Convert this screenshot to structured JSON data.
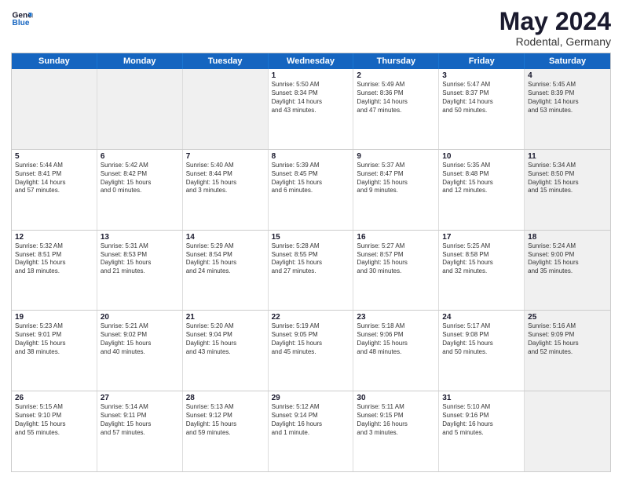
{
  "logo": {
    "line1": "General",
    "line2": "Blue"
  },
  "title": "May 2024",
  "location": "Rodental, Germany",
  "weekdays": [
    "Sunday",
    "Monday",
    "Tuesday",
    "Wednesday",
    "Thursday",
    "Friday",
    "Saturday"
  ],
  "rows": [
    [
      {
        "day": "",
        "text": "",
        "shaded": true
      },
      {
        "day": "",
        "text": "",
        "shaded": true
      },
      {
        "day": "",
        "text": "",
        "shaded": true
      },
      {
        "day": "1",
        "text": "Sunrise: 5:50 AM\nSunset: 8:34 PM\nDaylight: 14 hours\nand 43 minutes."
      },
      {
        "day": "2",
        "text": "Sunrise: 5:49 AM\nSunset: 8:36 PM\nDaylight: 14 hours\nand 47 minutes."
      },
      {
        "day": "3",
        "text": "Sunrise: 5:47 AM\nSunset: 8:37 PM\nDaylight: 14 hours\nand 50 minutes."
      },
      {
        "day": "4",
        "text": "Sunrise: 5:45 AM\nSunset: 8:39 PM\nDaylight: 14 hours\nand 53 minutes.",
        "shaded": true
      }
    ],
    [
      {
        "day": "5",
        "text": "Sunrise: 5:44 AM\nSunset: 8:41 PM\nDaylight: 14 hours\nand 57 minutes."
      },
      {
        "day": "6",
        "text": "Sunrise: 5:42 AM\nSunset: 8:42 PM\nDaylight: 15 hours\nand 0 minutes."
      },
      {
        "day": "7",
        "text": "Sunrise: 5:40 AM\nSunset: 8:44 PM\nDaylight: 15 hours\nand 3 minutes."
      },
      {
        "day": "8",
        "text": "Sunrise: 5:39 AM\nSunset: 8:45 PM\nDaylight: 15 hours\nand 6 minutes."
      },
      {
        "day": "9",
        "text": "Sunrise: 5:37 AM\nSunset: 8:47 PM\nDaylight: 15 hours\nand 9 minutes."
      },
      {
        "day": "10",
        "text": "Sunrise: 5:35 AM\nSunset: 8:48 PM\nDaylight: 15 hours\nand 12 minutes."
      },
      {
        "day": "11",
        "text": "Sunrise: 5:34 AM\nSunset: 8:50 PM\nDaylight: 15 hours\nand 15 minutes.",
        "shaded": true
      }
    ],
    [
      {
        "day": "12",
        "text": "Sunrise: 5:32 AM\nSunset: 8:51 PM\nDaylight: 15 hours\nand 18 minutes."
      },
      {
        "day": "13",
        "text": "Sunrise: 5:31 AM\nSunset: 8:53 PM\nDaylight: 15 hours\nand 21 minutes."
      },
      {
        "day": "14",
        "text": "Sunrise: 5:29 AM\nSunset: 8:54 PM\nDaylight: 15 hours\nand 24 minutes."
      },
      {
        "day": "15",
        "text": "Sunrise: 5:28 AM\nSunset: 8:55 PM\nDaylight: 15 hours\nand 27 minutes."
      },
      {
        "day": "16",
        "text": "Sunrise: 5:27 AM\nSunset: 8:57 PM\nDaylight: 15 hours\nand 30 minutes."
      },
      {
        "day": "17",
        "text": "Sunrise: 5:25 AM\nSunset: 8:58 PM\nDaylight: 15 hours\nand 32 minutes."
      },
      {
        "day": "18",
        "text": "Sunrise: 5:24 AM\nSunset: 9:00 PM\nDaylight: 15 hours\nand 35 minutes.",
        "shaded": true
      }
    ],
    [
      {
        "day": "19",
        "text": "Sunrise: 5:23 AM\nSunset: 9:01 PM\nDaylight: 15 hours\nand 38 minutes."
      },
      {
        "day": "20",
        "text": "Sunrise: 5:21 AM\nSunset: 9:02 PM\nDaylight: 15 hours\nand 40 minutes."
      },
      {
        "day": "21",
        "text": "Sunrise: 5:20 AM\nSunset: 9:04 PM\nDaylight: 15 hours\nand 43 minutes."
      },
      {
        "day": "22",
        "text": "Sunrise: 5:19 AM\nSunset: 9:05 PM\nDaylight: 15 hours\nand 45 minutes."
      },
      {
        "day": "23",
        "text": "Sunrise: 5:18 AM\nSunset: 9:06 PM\nDaylight: 15 hours\nand 48 minutes."
      },
      {
        "day": "24",
        "text": "Sunrise: 5:17 AM\nSunset: 9:08 PM\nDaylight: 15 hours\nand 50 minutes."
      },
      {
        "day": "25",
        "text": "Sunrise: 5:16 AM\nSunset: 9:09 PM\nDaylight: 15 hours\nand 52 minutes.",
        "shaded": true
      }
    ],
    [
      {
        "day": "26",
        "text": "Sunrise: 5:15 AM\nSunset: 9:10 PM\nDaylight: 15 hours\nand 55 minutes."
      },
      {
        "day": "27",
        "text": "Sunrise: 5:14 AM\nSunset: 9:11 PM\nDaylight: 15 hours\nand 57 minutes."
      },
      {
        "day": "28",
        "text": "Sunrise: 5:13 AM\nSunset: 9:12 PM\nDaylight: 15 hours\nand 59 minutes."
      },
      {
        "day": "29",
        "text": "Sunrise: 5:12 AM\nSunset: 9:14 PM\nDaylight: 16 hours\nand 1 minute."
      },
      {
        "day": "30",
        "text": "Sunrise: 5:11 AM\nSunset: 9:15 PM\nDaylight: 16 hours\nand 3 minutes."
      },
      {
        "day": "31",
        "text": "Sunrise: 5:10 AM\nSunset: 9:16 PM\nDaylight: 16 hours\nand 5 minutes."
      },
      {
        "day": "",
        "text": "",
        "shaded": true
      }
    ]
  ]
}
